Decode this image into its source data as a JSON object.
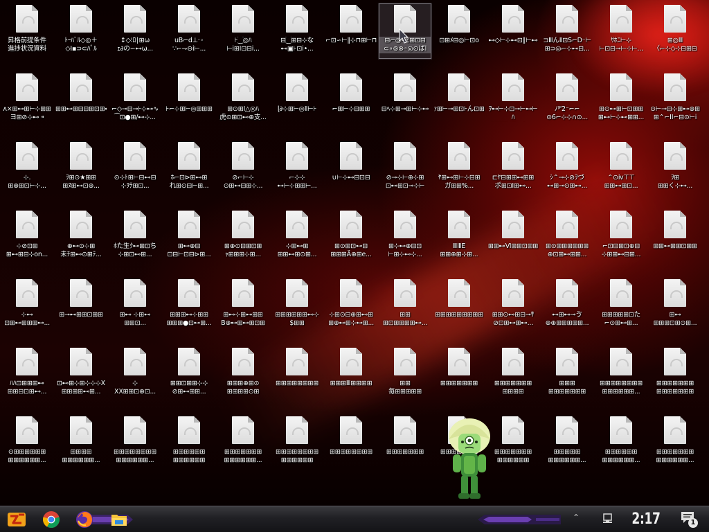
{
  "desktop": {
    "icons": [
      {
        "label": "昇格前提条件\n進捗状況資料",
        "selected": false
      },
      {
        "label": "ﾄｰﾊﾞﾙ◇◎＋\n◇Ⅰ▪⊃⊂ﾊﾟﾙ",
        "selected": false
      },
      {
        "label": "↕◇⁝ﾛ∣⊞ω\nｪ∂の∽⊷ω...",
        "selected": false
      },
      {
        "label": "uB⌐d⊥·◦\n∵⌐⇁⊖ⅰ⊢...",
        "selected": false
      },
      {
        "label": "⊦⁐◎ﾊ\n⊢ⅰ⊞Ⅰ⊡⊟ⅰ...",
        "selected": false
      },
      {
        "label": "⊟⁐⊞⊟⊹な\n⊷▣⊦⊡ⅰ•...",
        "selected": false
      },
      {
        "label": "⌐⊡∽⊢∥⊹⊓⊞⊢⊓⊡",
        "selected": false
      },
      {
        "label": "⊟⌐◎∽ﾋ⊞⊡⊟\n⊂∘⊚⊗◦◎⊙ばl",
        "selected": true
      },
      {
        "label": "⊡⊞ﾒ⊟◎⊢⊡o",
        "selected": false
      },
      {
        "label": "⊷◇⊢⊹⊷⊡∥⊢⊷",
        "selected": false
      },
      {
        "label": "⊐ⅢんⅡ⊡S⌐D⁻⊢\n⊞⊃◎⌐⊹⊷⊟...",
        "selected": false
      },
      {
        "label": "ｻﾎﾆ⊢⊹\n⊢⊡⊟⊸⊢⊹⊢...",
        "selected": false
      },
      {
        "label": "⊞◎Ⅲ\n〈⌐⊹◇⊹⊟⊞⊟",
        "selected": false
      },
      {
        "label": "ᴧ×⊞⊷⊞⊢⊹⊞⊞\nヨ⊞⊘⊹⊷ ⁌",
        "selected": false
      },
      {
        "label": "⊞⊞⊷⊞⊟⊟⊞⊡⊞⊷",
        "selected": false
      },
      {
        "label": "⌐◇⊸⊟⊸⊦⊹⊷∿\n⁀⊡●⊞∕⊷⊹...",
        "selected": false
      },
      {
        "label": "⊦⌐⊹⊞⊢◎⊞⊞⊞",
        "selected": false
      },
      {
        "label": "⊞⊙⊞Ⅰ△◎ﾊ\n虎⊙⊞⊡⊷⊕支...",
        "selected": false
      },
      {
        "label": "ɭ∂⊹⊞⊢◎Ⅱ⊢⊦",
        "selected": false
      },
      {
        "label": "⌐⊞⊢⊹⊟⊞⊞",
        "selected": false
      },
      {
        "label": "⊟ﾍ⊹⊞⊸⊞⊢⊹⊷",
        "selected": false
      },
      {
        "label": "ｧ⊞⊢⊸⊞⊡⊦ん⊡⊞",
        "selected": false
      },
      {
        "label": "ｦ⊷⊢⊹⊡⊸⊢⊷⊢ﾊ\n⊦⊡⊟⊢⊞⊷⊢...",
        "selected": false
      },
      {
        "label": "ﾉ⁾ᴾ2⁻⌐⌐\n⊙6⌐⊹⊹∩⊙...",
        "selected": false
      },
      {
        "label": "⊞⊙⊷⊞⊢⊡⊞⊞\n⊞⊷⊢⊹⊷⊞⊞...",
        "selected": false
      },
      {
        "label": "⊙⊢⊸⊟⊹⊞⊷⊕⊞\n⊞⌃⌐ⅠⅠ⌐⊟⊙⊢ⅰ",
        "selected": false
      },
      {
        "label": "⊹.\n⊞⊕⊞⊡⊢⊹...",
        "selected": false
      },
      {
        "label": "ｦ⊞⊙★⊞⊞\n⊞ﾇ⊞⊷⊡⊕...",
        "selected": false
      },
      {
        "label": "⊙⊹ﾄ⊞⊢⊟⊷⊟\n⊹ｦﾃ⊞⊡...",
        "selected": false
      },
      {
        "label": "ﾎ⌐⊡⊳⊞⊷⊞\nれ⊞⊙⊟⊢⊞...",
        "selected": false
      },
      {
        "label": "⊘⌐⊢⊹\n⊙⊞⊷⊟⊞⊹...",
        "selected": false
      },
      {
        "label": "⌐⊹⊹\n⊷⊢⊹⊞⊞⊢...",
        "selected": false
      },
      {
        "label": "∪⊢⊹⊷⊟⊡⊟",
        "selected": false
      },
      {
        "label": "⊘⊸⊹⊢⊕⊹⊞\n⊡⊷⊞⊡⊸⊹⊢",
        "selected": false
      },
      {
        "label": "ﾔ⊞⊷⊞⊢⊹⊟⊞\nガ⊞⊞%...",
        "selected": false
      },
      {
        "label": "⊏ﾔ⊟⊞⊞⊷⊞⊞\nポ⊞⊡Ⅰ⊞⊷...",
        "selected": false
      },
      {
        "label": "ｼ⌃⊸⊹⊘ｦづ\n⊷⊞⊸⊙⊞⊷...",
        "selected": false
      },
      {
        "label": "⌃⊙ⅳ⊤⊤\n⊞⊞⊷⊞⊡...",
        "selected": false
      },
      {
        "label": "ｦ⊞\n⊞⊞く⊹⊷...",
        "selected": false
      },
      {
        "label": "⊹⊘⊡⊞\n⊞⊷⊞⊟⊹on...",
        "selected": false
      },
      {
        "label": "⊕⊷⊙⊹⊞\n未ﾁ⊞⊷⊙⊞ﾃ...",
        "selected": false
      },
      {
        "label": "ﾎた生ｸ⊷⊞⊡ち\n⊹⊞⊡⊷⊞...",
        "selected": false
      },
      {
        "label": "⊞⊷⊕⊟\n⊡⊟⊢⊡⊟⊳⊞...",
        "selected": false
      },
      {
        "label": "⊞⊕⊙⊟⊞⊡⊞\nｬ⊞⊞⊞⊹⊞...",
        "selected": false
      },
      {
        "label": "⊹⊞⊷⊞\n⊞⊞⊷⊞⊙⊞...",
        "selected": false
      },
      {
        "label": "⊞⊙⊞⊡⊷⊟\n⊞⊞⊞Ä⊕⊞e...",
        "selected": false
      },
      {
        "label": "⊞⊹⊷⊕⊟⊡\n⊢⊞⊹⊷⊹...",
        "selected": false
      },
      {
        "label": "ⅢⅢĖ\n⊞⊞⊕⊞⊹⊞...",
        "selected": false
      },
      {
        "label": "⊞⊞⊷Ⅵ⊞⊞⊡⊞⊞",
        "selected": false
      },
      {
        "label": "⊞⊙⊞⊞⊞⊞⊞⊞\n⊕⊡⊞⊷⊞⊞...",
        "selected": false
      },
      {
        "label": "⌐⊡⊟⊞⊡⊕⊟\n⊹⊞⊞⊷⊟⊞...",
        "selected": false
      },
      {
        "label": "⊞⊞⊷⊞⊞⊡⊞⊞",
        "selected": false
      },
      {
        "label": "⊹⊷\n⊡⊞⊷⊞⊞⊞⊷...",
        "selected": false
      },
      {
        "label": "⊞⊸⊷⊞⊞⊡⊞⊞",
        "selected": false
      },
      {
        "label": "⊞⊷ ⊹⊞⊷ ⊞⊞⊡...",
        "selected": false
      },
      {
        "label": "⊞⊞⊞⊷⊹⊞⊞\n⊞⊞⊞●⊡⊷⊞...",
        "selected": false
      },
      {
        "label": "⊞⊷⊹⊞⊷⊞⊞\nB⊕⊷⊞⊷⊞⊡⊞",
        "selected": false
      },
      {
        "label": "⊞⊞⊞⊞⊞⊞⊷⊹\n$⊞⊞",
        "selected": false
      },
      {
        "label": "⊹⊞⊙⊟⊕⊞⊷⊞\n⊞⊕⊷⊞⊹⊷⊞...",
        "selected": false
      },
      {
        "label": "⊞⊞\n⊞⊡⊞⊞⊞⊞⊷...",
        "selected": false
      },
      {
        "label": "⊞⊞⊞⊞⊞⊞⊞⊞⊞",
        "selected": false
      },
      {
        "label": "⊞⊞⊙⊷⊞⊟⊸ｻ\n⊘⊡⊞⊷⊞⊷...",
        "selected": false
      },
      {
        "label": "⊷⊞⊷⊸ゔ\n⊕⊕⊞⊞⊞⊞⊞...",
        "selected": false
      },
      {
        "label": "⊞⊞⊞⊞⊞⊡た\n⌐⊙⊞⊷⊞...",
        "selected": false
      },
      {
        "label": "⊞⊷\n⊞⊞⊞⊡⊞⊙⊞...",
        "selected": false
      },
      {
        "label": "ﾊﾊ⊡⊞⊞⊞⊷\n⊞⊞⊟⊡⊞⊷...",
        "selected": false
      },
      {
        "label": "⊡⊷⊞⊹⊞⊹⊹⊹X\n⊞⊞⊞⊞⊷⊞...",
        "selected": false
      },
      {
        "label": "⊹\nXX⊞⊞⊡⊕⊡...",
        "selected": false
      },
      {
        "label": "⊞⊞⊡⊞⊞⊹⊹\n⊘⊞⊷⊞⊞...",
        "selected": false
      },
      {
        "label": "⊞⊞⊞⊕⊞⊙\n⊞⊞⊞⊞⊙⊞",
        "selected": false
      },
      {
        "label": "⊞⊞⊞⊞⊞⊞⊞⊞",
        "selected": false
      },
      {
        "label": "⊞⊞⊞Ⅲ⊞⊞⊞⊞",
        "selected": false
      },
      {
        "label": "⊞⊞\n毎⊞⊞⊞⊞⊞",
        "selected": false
      },
      {
        "label": "⊞⊞⊞⊞⊞⊞⊞",
        "selected": false
      },
      {
        "label": "⊞⊞⊞⊞⊞⊞⊞\n⊞⊞⊞⊞",
        "selected": false
      },
      {
        "label": "⊞⊞⊞\n⊞⊞⊞⊞⊞⊞⊞",
        "selected": false
      },
      {
        "label": "⊞⊞⊞⊞⊞⊞⊞⊞\n⊞⊞⊞⊞⊞⊞...",
        "selected": false
      },
      {
        "label": "⊞⊞⊞⊞⊞⊞⊞\n⊞⊞⊞⊞⊞⊞⊞",
        "selected": false
      },
      {
        "label": "⊙⊞⊞⊞⊞⊞⊞\n⊞⊞⊞⊞⊞⊞...",
        "selected": false
      },
      {
        "label": "⊞⊞⊞⊞\n⊞⊞⊞⊞⊞⊞...",
        "selected": false
      },
      {
        "label": "⊞⊞⊞⊞⊞⊞⊞⊞\n⊞⊞⊞⊞⊞⊞...",
        "selected": false
      },
      {
        "label": "⊞⊞⊞⊞⊞⊞\n⊞⊞⊞⊞⊞⊞",
        "selected": false
      },
      {
        "label": "⊞⊞⊞⊞⊞⊞⊞\n⊞⊞⊞⊞⊞⊞...",
        "selected": false
      },
      {
        "label": "⊞⊞⊞⊞⊞⊞⊞⊞\n⊞⊞⊞⊞⊞⊞",
        "selected": false
      },
      {
        "label": "⊞⊞⊞⊞⊞⊞⊞⊞",
        "selected": false
      },
      {
        "label": "⊞⊞⊞⊞⊞⊞⊞",
        "selected": false
      },
      {
        "label": "⊞⊞⊞⊞⊞⊞⊞",
        "selected": false
      },
      {
        "label": "⊞⊞⊞⊞⊞⊞⊞\n⊞⊞⊞⊞⊞⊞",
        "selected": false
      },
      {
        "label": "⊞⊞⊞⊞⊞\n⊞⊞⊞⊞⊞⊞...",
        "selected": false
      },
      {
        "label": "⊞⊞⊞⊞⊞⊞\n⊞⊞⊞⊞⊞⊞...",
        "selected": false
      },
      {
        "label": "⊞⊞⊞⊞⊞⊞⊞\n⊞⊞⊞⊞⊞⊞...",
        "selected": false
      }
    ]
  },
  "taskbar": {
    "pinned": [
      "start-icon",
      "chrome-icon",
      "firefox-icon",
      "file-explorer-icon"
    ],
    "tray": {
      "overflow_icon": "chevron-up-icon",
      "network_icon": "network-icon",
      "clock": "2:17 AM",
      "notification_count": "1"
    }
  },
  "colors": {
    "wallpaper_red": "#960c08",
    "taskbar_dark": "#202024",
    "accent_purple": "#6a3fb0",
    "label_text": "#ffffff"
  }
}
